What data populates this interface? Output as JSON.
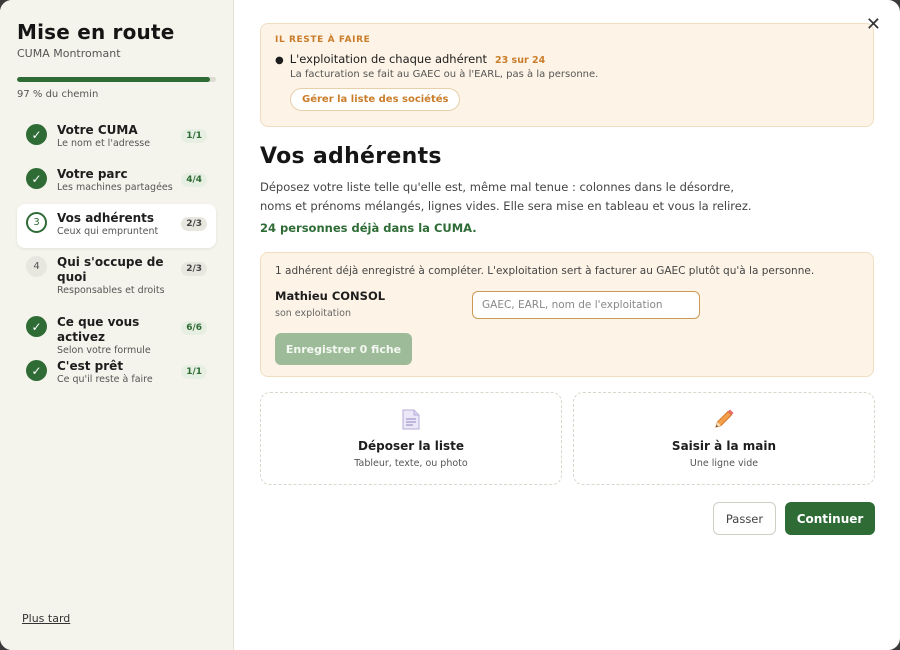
{
  "sidebar": {
    "title": "Mise en route",
    "org": "CUMA Montromant",
    "progress": {
      "percent": 97,
      "label": "97 % du chemin"
    },
    "steps": [
      {
        "icon": "✓",
        "state": "done",
        "title": "Votre CUMA",
        "desc": "Le nom et l'adresse",
        "badge": "1/1"
      },
      {
        "icon": "✓",
        "state": "done",
        "title": "Votre parc",
        "desc": "Les machines partagées",
        "badge": "4/4"
      },
      {
        "icon": "3",
        "state": "current",
        "title": "Vos adhérents",
        "desc": "Ceux qui empruntent",
        "badge": "2/3"
      },
      {
        "icon": "4",
        "state": "todo",
        "title": "Qui s'occupe de quoi",
        "desc": "Responsables et droits",
        "badge": "2/3"
      },
      {
        "icon": "✓",
        "state": "done",
        "title": "Ce que vous activez",
        "desc": "Selon votre formule",
        "badge": "6/6"
      },
      {
        "icon": "✓",
        "state": "done",
        "title": "C'est prêt",
        "desc": "Ce qu'il reste à faire",
        "badge": "1/1"
      }
    ],
    "later": "Plus tard"
  },
  "close": "✕",
  "alert": {
    "heading": "IL RESTE À FAIRE",
    "item": "L'exploitation de chaque adhérent",
    "count": "23 sur 24",
    "note": "La facturation se fait au GAEC ou à l'EARL, pas à la personne.",
    "button": "Gérer la liste des sociétés"
  },
  "main": {
    "title": "Vos adhérents",
    "lead": "Déposez votre liste telle qu'elle est, même mal tenue : colonnes dans le désordre, noms et prénoms mélangés, lignes vides. Elle sera mise en tableau et vous la relirez.",
    "count_line": "24 personnes déjà dans la CUMA."
  },
  "card": {
    "info": "1 adhérent déjà enregistré à compléter. L'exploitation sert à facturer au GAEC plutôt qu'à la personne.",
    "member_name": "Mathieu CONSOL",
    "member_hint": "son exploitation",
    "input_placeholder": "GAEC, EARL, nom de l'exploitation",
    "save_button": "Enregistrer 0 fiche"
  },
  "options": [
    {
      "icon": "document-icon",
      "title": "Déposer la liste",
      "desc": "Tableur, texte, ou photo"
    },
    {
      "icon": "pencil-icon",
      "title": "Saisir à la main",
      "desc": "Une ligne vide"
    }
  ],
  "footer": {
    "skip": "Passer",
    "continue": "Continuer"
  },
  "colors": {
    "accent": "#2e6b35",
    "warning": "#c97d2a",
    "alert_bg": "#fdf4e7"
  }
}
